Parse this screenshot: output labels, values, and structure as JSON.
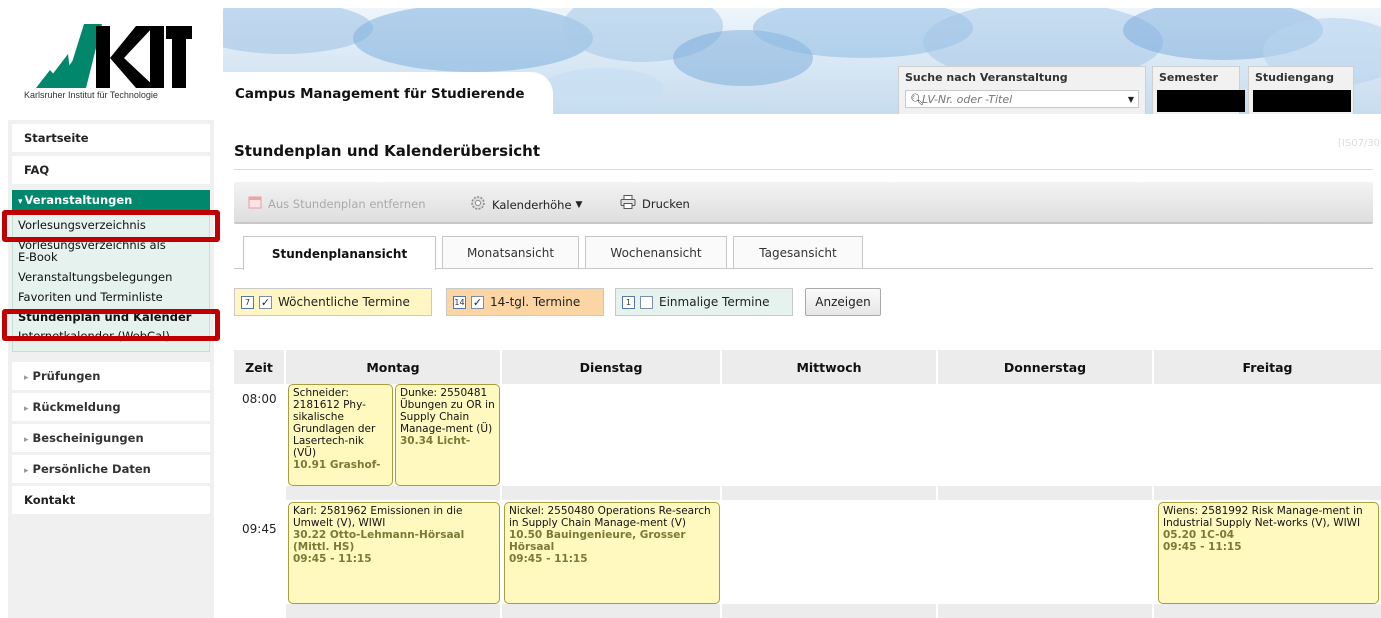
{
  "header": {
    "logo_caption": "Karlsruher Institut für Technologie",
    "site_title": "Campus Management für Studierende",
    "search": {
      "label": "Suche nach Veranstaltung",
      "placeholder": "LV-Nr. oder -Titel"
    },
    "semester_label": "Semester",
    "studiengang_label": "Studiengang"
  },
  "sidebar": {
    "items": [
      {
        "label": "Startseite"
      },
      {
        "label": "FAQ"
      },
      {
        "label": "Veranstaltungen"
      },
      {
        "label": "Prüfungen"
      },
      {
        "label": "Rückmeldung"
      },
      {
        "label": "Bescheinigungen"
      },
      {
        "label": "Persönliche Daten"
      },
      {
        "label": "Kontakt"
      }
    ],
    "sub_items": [
      {
        "label": "Vorlesungsverzeichnis"
      },
      {
        "label": "Vorlesungsverzeichnis als"
      },
      {
        "label": "E-Book"
      },
      {
        "label": "Veranstaltungsbelegungen"
      },
      {
        "label": "Favoriten und Terminliste"
      },
      {
        "label": "Stundenplan und Kalender"
      },
      {
        "label": "Internetkalender (WebCal)"
      }
    ]
  },
  "main": {
    "title": "Stundenplan und Kalenderübersicht",
    "page_code": "[IS07/300",
    "toolbar": {
      "remove": "Aus Stundenplan entfernen",
      "height": "Kalenderhöhe",
      "print": "Drucken"
    },
    "tabs": [
      {
        "label": "Stundenplanansicht"
      },
      {
        "label": "Monatsansicht"
      },
      {
        "label": "Wochenansicht"
      },
      {
        "label": "Tagesansicht"
      }
    ],
    "filters": {
      "weekly": {
        "icon_num": "7",
        "label": "Wöchentliche Termine",
        "checked": true
      },
      "biweekly": {
        "icon_num": "14",
        "label": "14-tgl. Termine",
        "checked": true
      },
      "single": {
        "icon_num": "1",
        "label": "Einmalige Termine",
        "checked": false
      },
      "show_button": "Anzeigen"
    },
    "schedule": {
      "headers": [
        "Zeit",
        "Montag",
        "Dienstag",
        "Mittwoch",
        "Donnerstag",
        "Freitag"
      ],
      "times": [
        "08:00",
        "09:45"
      ],
      "events": {
        "e1": {
          "title": "Schneider: 2181612 Phy-sikalische Grundlagen der Lasertech-nik (VÜ)",
          "room": "10.91 Grashof-"
        },
        "e2": {
          "title": "Dunke: 2550481 Übungen zu OR in Supply Chain Manage-ment (Ü)",
          "room": "30.34 Licht-"
        },
        "e3": {
          "title": "Karl: 2581962 Emissionen in die Umwelt (V), WIWI",
          "room": "30.22 Otto-Lehmann-Hörsaal (Mittl. HS)",
          "time": "09:45 - 11:15"
        },
        "e4": {
          "title": "Nickel: 2550480 Operations Re-search in Supply Chain Manage-ment (V)",
          "room": "10.50 Bauingenieure, Grosser Hörsaal",
          "time": "09:45 - 11:15"
        },
        "e5": {
          "title": "Wiens: 2581992 Risk Manage-ment in Industrial Supply Net-works (V), WIWI",
          "room": "05.20 1C-04",
          "time": "09:45 - 11:15"
        }
      }
    }
  },
  "colors": {
    "kit_green": "#00876c",
    "highlight_red": "#c00000",
    "event_yellow": "#fff9bf"
  }
}
